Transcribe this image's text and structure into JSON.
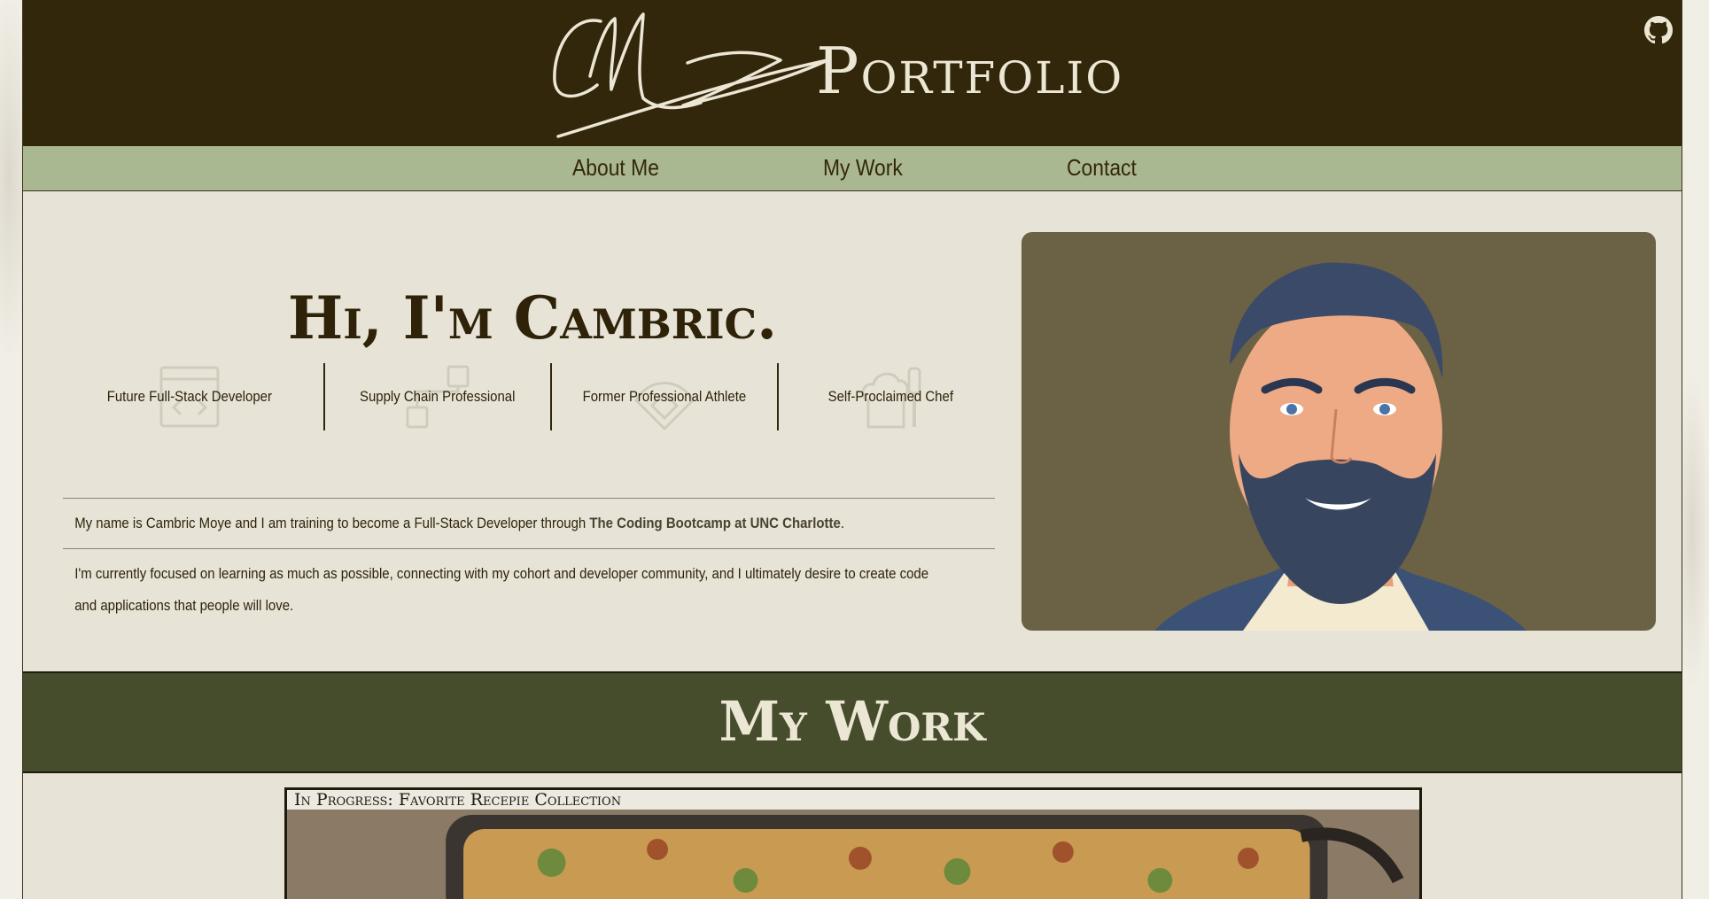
{
  "header": {
    "signature_initials": "CM",
    "brand_title": "Portfolio"
  },
  "nav": {
    "items": [
      {
        "label": "About Me"
      },
      {
        "label": "My Work"
      },
      {
        "label": "Contact"
      }
    ]
  },
  "hero": {
    "title": "Hi, I'm Cambric.",
    "roles": [
      {
        "label": "Future Full-Stack Developer",
        "icon": "browser-window-icon"
      },
      {
        "label": "Supply Chain Professional",
        "icon": "network-boxes-icon"
      },
      {
        "label": "Former Professional Athlete",
        "icon": "baseball-diamond-icon"
      },
      {
        "label": "Self-Proclaimed Chef",
        "icon": "chef-tools-icon"
      }
    ]
  },
  "about": {
    "p1_prefix": "My name is Cambric Moye and I am training to become a Full-Stack Developer through ",
    "p1_bold": "The Coding Bootcamp at UNC Charlotte",
    "p1_suffix": ".",
    "p2": "I'm currently focused on learning as much as possible, connecting with my cohort and developer community, and I ultimately desire to create code and applications that people will love."
  },
  "work": {
    "section_title": "My Work",
    "projects": [
      {
        "label": "In Progress: Favorite Recepie Collection"
      }
    ]
  },
  "colors": {
    "header_bg": "#33270b",
    "nav_bg": "#aab892",
    "page_bg": "#e7e4d7",
    "portrait_bg": "#6b6144",
    "work_band_bg": "#454d2c",
    "light_text": "#ece6d4"
  }
}
